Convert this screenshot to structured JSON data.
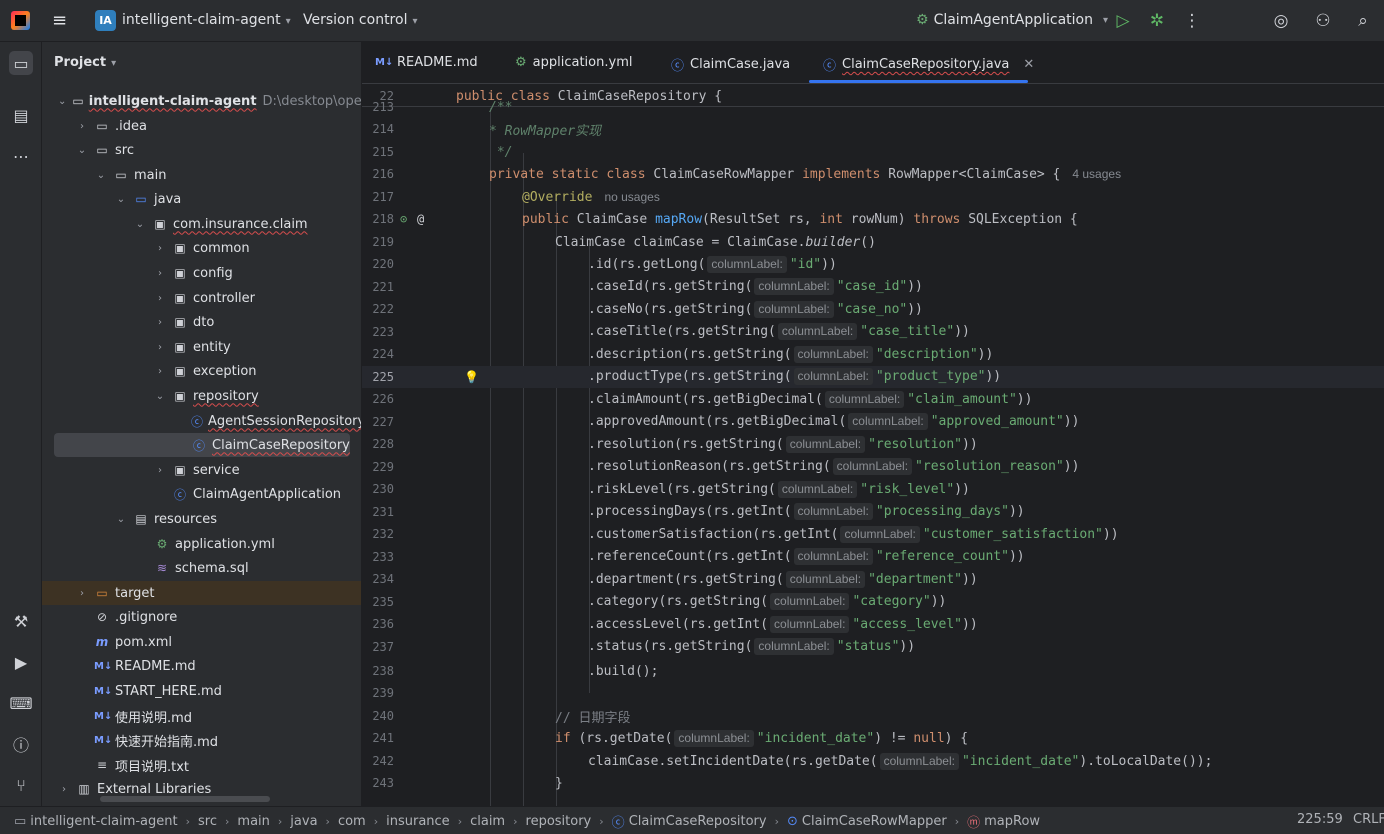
{
  "titlebar": {
    "project_badge": "IA",
    "project_name": "intelligent-claim-agent",
    "vcs": "Version control",
    "run_config": "ClaimAgentApplication"
  },
  "panel": {
    "title": "Project"
  },
  "tree": [
    {
      "label": "intelligent-claim-agent",
      "hint": "D:\\desktop\\openga"
    },
    {
      "label": ".idea"
    },
    {
      "label": "src"
    },
    {
      "label": "main"
    },
    {
      "label": "java"
    },
    {
      "label": "com.insurance.claim"
    },
    {
      "label": "common"
    },
    {
      "label": "config"
    },
    {
      "label": "controller"
    },
    {
      "label": "dto"
    },
    {
      "label": "entity"
    },
    {
      "label": "exception"
    },
    {
      "label": "repository"
    },
    {
      "label": "AgentSessionRepository"
    },
    {
      "label": "ClaimCaseRepository"
    },
    {
      "label": "service"
    },
    {
      "label": "ClaimAgentApplication"
    },
    {
      "label": "resources"
    },
    {
      "label": "application.yml"
    },
    {
      "label": "schema.sql"
    },
    {
      "label": "target"
    },
    {
      "label": ".gitignore"
    },
    {
      "label": "pom.xml"
    },
    {
      "label": "README.md"
    },
    {
      "label": "START_HERE.md"
    },
    {
      "label": "使用说明.md"
    },
    {
      "label": "快速开始指南.md"
    },
    {
      "label": "项目说明.txt"
    },
    {
      "label": "External Libraries"
    }
  ],
  "tabs": [
    {
      "label": "README.md",
      "icon": "M↓"
    },
    {
      "label": "application.yml",
      "icon": "yml"
    },
    {
      "label": "ClaimCase.java",
      "icon": "C"
    },
    {
      "label": "ClaimCaseRepository.java",
      "icon": "C"
    }
  ],
  "editor": {
    "sticky_line": "22",
    "sticky_code": "public class ClaimCaseRepository {",
    "line_numbers": [
      "213",
      "214",
      "215",
      "216",
      "217",
      "218",
      "219",
      "220",
      "221",
      "222",
      "223",
      "224",
      "225",
      "226",
      "227",
      "228",
      "229",
      "230",
      "231",
      "232",
      "233",
      "234",
      "235",
      "236",
      "237",
      "238",
      "239",
      "240",
      "241",
      "242",
      "243"
    ],
    "usages_4": "4 usages",
    "no_usages": "no usages",
    "hint_label": "columnLabel:",
    "comment_doc": "* RowMapper实现",
    "comment_date": "// 日期字段",
    "fields": [
      {
        "method": ".id",
        "getter": "getLong",
        "col": "\"id\""
      },
      {
        "method": ".caseId",
        "getter": "getString",
        "col": "\"case_id\""
      },
      {
        "method": ".caseNo",
        "getter": "getString",
        "col": "\"case_no\""
      },
      {
        "method": ".caseTitle",
        "getter": "getString",
        "col": "\"case_title\""
      },
      {
        "method": ".description",
        "getter": "getString",
        "col": "\"description\""
      },
      {
        "method": ".productType",
        "getter": "getString",
        "col": "\"product_type\""
      },
      {
        "method": ".claimAmount",
        "getter": "getBigDecimal",
        "col": "\"claim_amount\""
      },
      {
        "method": ".approvedAmount",
        "getter": "getBigDecimal",
        "col": "\"approved_amount\""
      },
      {
        "method": ".resolution",
        "getter": "getString",
        "col": "\"resolution\""
      },
      {
        "method": ".resolutionReason",
        "getter": "getString",
        "col": "\"resolution_reason\""
      },
      {
        "method": ".riskLevel",
        "getter": "getString",
        "col": "\"risk_level\""
      },
      {
        "method": ".processingDays",
        "getter": "getInt",
        "col": "\"processing_days\""
      },
      {
        "method": ".customerSatisfaction",
        "getter": "getInt",
        "col": "\"customer_satisfaction\""
      },
      {
        "method": ".referenceCount",
        "getter": "getInt",
        "col": "\"reference_count\""
      },
      {
        "method": ".department",
        "getter": "getString",
        "col": "\"department\""
      },
      {
        "method": ".category",
        "getter": "getString",
        "col": "\"category\""
      },
      {
        "method": ".accessLevel",
        "getter": "getInt",
        "col": "\"access_level\""
      },
      {
        "method": ".status",
        "getter": "getString",
        "col": "\"status\""
      }
    ]
  },
  "statusbar": {
    "crumbs": [
      "intelligent-claim-agent",
      "src",
      "main",
      "java",
      "com",
      "insurance",
      "claim",
      "repository",
      "ClaimCaseRepository",
      "ClaimCaseRowMapper",
      "mapRow"
    ],
    "position": "225:59",
    "line_ending": "CRLF"
  }
}
